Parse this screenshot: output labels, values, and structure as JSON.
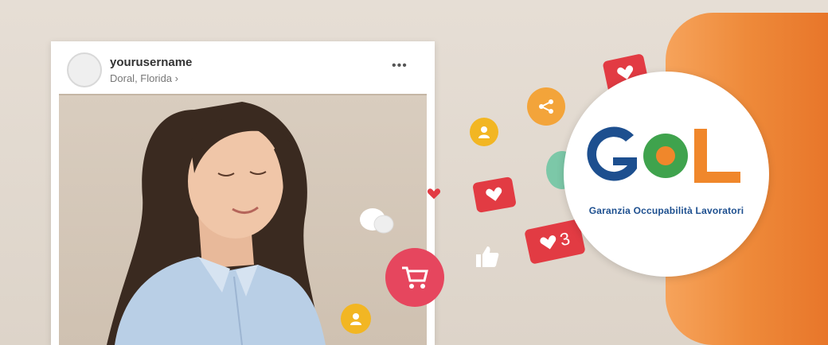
{
  "post": {
    "username": "yourusername",
    "location": "Doral, Florida ›",
    "more_label": "•••"
  },
  "logo": {
    "text": "GOL",
    "tagline": "Garanzia Occupabilità Lavoratori",
    "colors": {
      "blue": "#1d4f8f",
      "green": "#3fa34d",
      "orange": "#f0872b"
    }
  },
  "notifications": {
    "likes_count": "3"
  },
  "icons": [
    "user-icon",
    "share-icon",
    "heart-icon",
    "comment-icon",
    "cart-icon",
    "thumbs-up-icon",
    "like-counter-icon"
  ],
  "colors": {
    "orange_panel": "#ee8a3a",
    "background": "#e3dbd1"
  }
}
